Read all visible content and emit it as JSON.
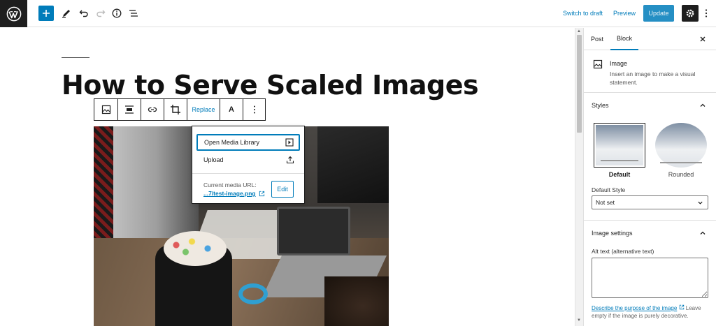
{
  "topbar": {
    "switch_to_draft": "Switch to draft",
    "preview": "Preview",
    "update": "Update"
  },
  "editor": {
    "title": "How to Serve Scaled Images"
  },
  "block_toolbar": {
    "replace": "Replace",
    "text_label": "A"
  },
  "replace_menu": {
    "open_media_library": "Open Media Library",
    "upload": "Upload",
    "current_media_url_label": "Current media URL:",
    "current_media_url": "...7/test-image.png",
    "edit": "Edit"
  },
  "sidebar": {
    "tabs": [
      {
        "label": "Post",
        "active": false
      },
      {
        "label": "Block",
        "active": true
      }
    ],
    "block_card": {
      "name": "Image",
      "description": "Insert an image to make a visual statement."
    },
    "styles": {
      "title": "Styles",
      "options": [
        {
          "label": "Default",
          "selected": true
        },
        {
          "label": "Rounded",
          "selected": false
        }
      ],
      "default_style_label": "Default Style",
      "default_style_value": "Not set"
    },
    "image_settings": {
      "title": "Image settings",
      "alt_label": "Alt text (alternative text)",
      "alt_value": "",
      "help_link": "Describe the purpose of the image",
      "help_rest": "Leave empty if the image is purely decorative."
    }
  },
  "colors": {
    "accent": "#007cba",
    "dark": "#1e1e1e"
  }
}
